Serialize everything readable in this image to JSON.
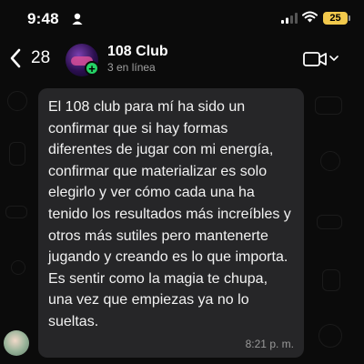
{
  "status_bar": {
    "time": "9:48",
    "battery": "25"
  },
  "header": {
    "back_count": "28",
    "chat_name": "108 Club",
    "chat_status": "3 en línea"
  },
  "message": {
    "text": "El 108 club para mí ha sido un confirmar que si hay formas diferentes de jugar con mi energía, confirmar que materializar es solo elegirlo y ver cómo cada una ha tenido los resultados más increíbles y otros más sutiles pero mantenerte jugando y creando es lo que importa. Es sentir como la magia te chupa, una vez que empiezas ya no lo sueltas.",
    "time": "8:21 p. m."
  },
  "colors": {
    "bubble": "#262628",
    "add_badge": "#25d366",
    "battery": "#f2c94c"
  }
}
